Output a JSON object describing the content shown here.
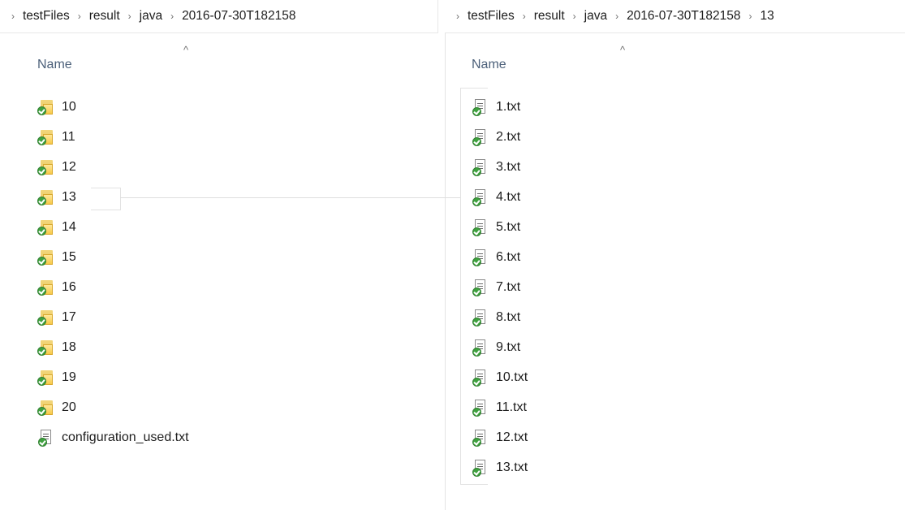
{
  "left_pane": {
    "breadcrumb": [
      "testFiles",
      "result",
      "java",
      "2016-07-30T182158"
    ],
    "column_header": "Name",
    "sort_indicator": "^",
    "items": [
      {
        "label": "10",
        "icon": "synced-folder-icon"
      },
      {
        "label": "11",
        "icon": "synced-folder-icon"
      },
      {
        "label": "12",
        "icon": "synced-folder-icon"
      },
      {
        "label": "13",
        "icon": "synced-folder-icon"
      },
      {
        "label": "14",
        "icon": "synced-folder-icon"
      },
      {
        "label": "15",
        "icon": "synced-folder-icon"
      },
      {
        "label": "16",
        "icon": "synced-folder-icon"
      },
      {
        "label": "17",
        "icon": "synced-folder-icon"
      },
      {
        "label": "18",
        "icon": "synced-folder-icon"
      },
      {
        "label": "19",
        "icon": "synced-folder-icon"
      },
      {
        "label": "20",
        "icon": "synced-folder-icon"
      },
      {
        "label": "configuration_used.txt",
        "icon": "synced-text-file-icon"
      }
    ]
  },
  "right_pane": {
    "breadcrumb": [
      "testFiles",
      "result",
      "java",
      "2016-07-30T182158",
      "13"
    ],
    "column_header": "Name",
    "sort_indicator": "^",
    "items": [
      {
        "label": "1.txt",
        "icon": "synced-text-file-icon"
      },
      {
        "label": "2.txt",
        "icon": "synced-text-file-icon"
      },
      {
        "label": "3.txt",
        "icon": "synced-text-file-icon"
      },
      {
        "label": "4.txt",
        "icon": "synced-text-file-icon"
      },
      {
        "label": "5.txt",
        "icon": "synced-text-file-icon"
      },
      {
        "label": "6.txt",
        "icon": "synced-text-file-icon"
      },
      {
        "label": "7.txt",
        "icon": "synced-text-file-icon"
      },
      {
        "label": "8.txt",
        "icon": "synced-text-file-icon"
      },
      {
        "label": "9.txt",
        "icon": "synced-text-file-icon"
      },
      {
        "label": "10.txt",
        "icon": "synced-text-file-icon"
      },
      {
        "label": "11.txt",
        "icon": "synced-text-file-icon"
      },
      {
        "label": "12.txt",
        "icon": "synced-text-file-icon"
      },
      {
        "label": "13.txt",
        "icon": "synced-text-file-icon"
      }
    ]
  }
}
